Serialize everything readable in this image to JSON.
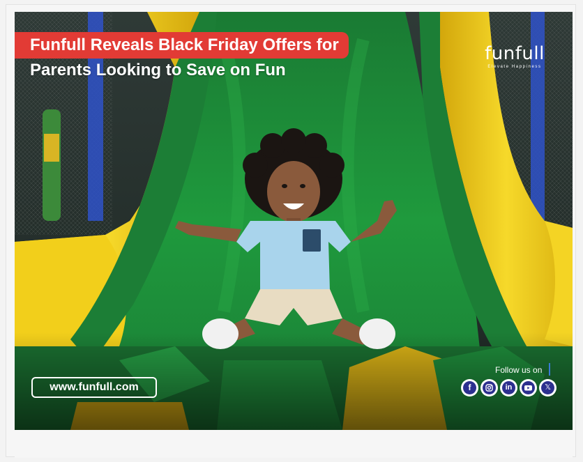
{
  "poster": {
    "headline_line1": "Funfull Reveals Black Friday Offers for",
    "headline_line2": "Parents Looking to Save on Fun",
    "brand": {
      "name": "funfull",
      "tagline": "Elevate Happiness"
    },
    "website": "www.funfull.com",
    "follow_label": "Follow us on",
    "social_icons": [
      "facebook-icon",
      "instagram-icon",
      "linkedin-icon",
      "youtube-icon",
      "x-icon"
    ],
    "colors": {
      "headline_bg": "#e23b35",
      "social_blue": "#2c2f8f",
      "slide_green": "#1f8a3a",
      "slide_yellow": "#f2cf1b"
    }
  }
}
